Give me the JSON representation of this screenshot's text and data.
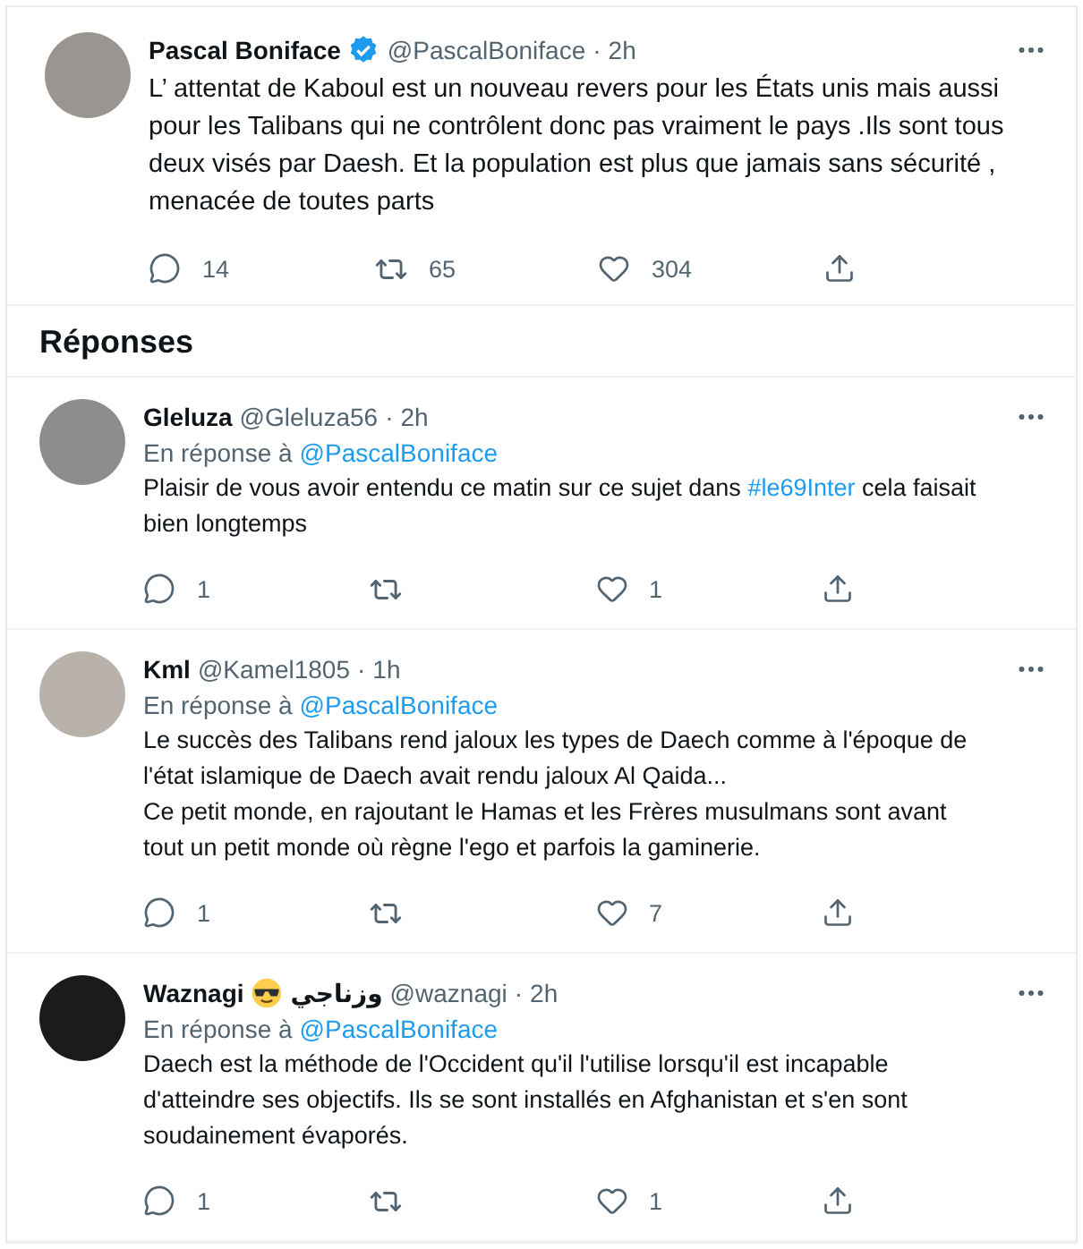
{
  "main_tweet": {
    "name": "Pascal Boniface",
    "verified": true,
    "handle": "@PascalBoniface",
    "separator": "·",
    "time": "2h",
    "text": [
      {
        "kind": "plain",
        "text": "L’ attentat de Kaboul est un nouveau revers pour les États unis mais aussi pour les Talibans qui ne contrôlent donc pas vraiment le pays .Ils sont tous deux visés par Daesh. Et la population est plus que jamais sans sécurité , menacée de toutes parts"
      }
    ],
    "replies": "14",
    "retweets": "65",
    "likes": "304"
  },
  "replies_heading": "Réponses",
  "replies": [
    {
      "name": "Gleluza",
      "handle": "@Gleluza56",
      "separator": "·",
      "time": "2h",
      "reply_prefix": "En réponse à",
      "reply_to": "@PascalBoniface",
      "text": [
        {
          "kind": "plain",
          "text": "Plaisir de vous avoir entendu ce matin sur ce sujet dans "
        },
        {
          "kind": "hashtag",
          "text": "#le69Inter"
        },
        {
          "kind": "plain",
          "text": " cela faisait bien longtemps"
        }
      ],
      "replies": "1",
      "likes": "1"
    },
    {
      "name": "Kml",
      "handle": "@Kamel1805",
      "separator": "·",
      "time": "1h",
      "reply_prefix": "En réponse à",
      "reply_to": "@PascalBoniface",
      "text": [
        {
          "kind": "plain",
          "text": "Le succès des Talibans rend jaloux les types de Daech comme à l'époque de l'état islamique de Daech avait rendu jaloux Al Qaida...\nCe petit monde, en rajoutant le Hamas et les Frères musulmans sont avant tout un petit monde où règne l'ego et parfois la gaminerie."
        }
      ],
      "replies": "1",
      "likes": "7"
    },
    {
      "name": "Waznagi",
      "sunglasses_emoji": true,
      "name_suffix": "وزناجي",
      "handle": "@waznagi",
      "separator": "·",
      "time": "2h",
      "reply_prefix": "En réponse à",
      "reply_to": "@PascalBoniface",
      "text": [
        {
          "kind": "plain",
          "text": "Daech  est la méthode de l'Occident qu'il l'utilise lorsqu'il est incapable d'atteindre ses objectifs. Ils se sont installés en Afghanistan et s'en sont soudainement évaporés."
        }
      ],
      "replies": "1",
      "likes": "1"
    }
  ]
}
